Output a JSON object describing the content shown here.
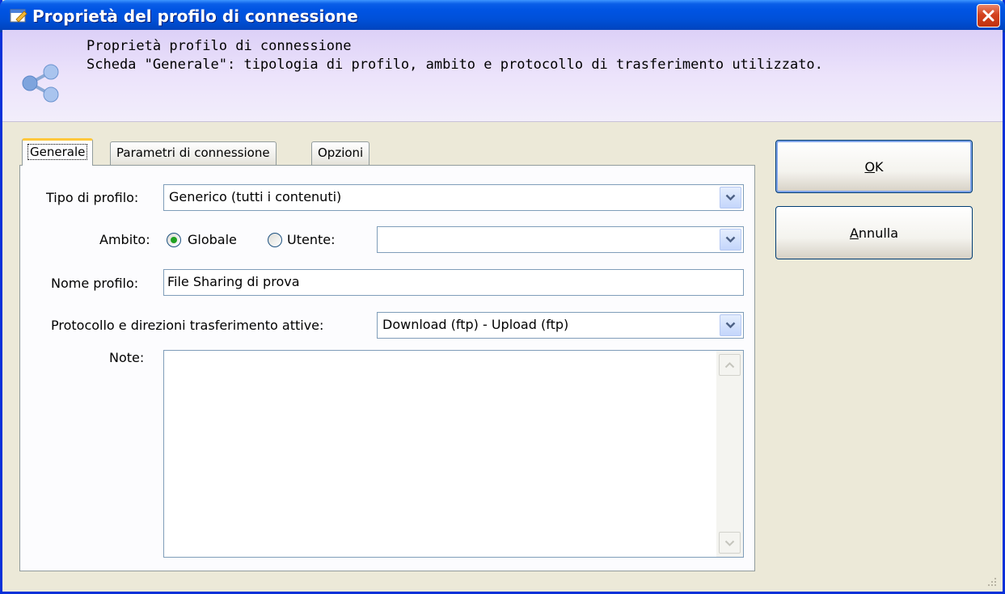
{
  "window": {
    "title": "Proprietà del profilo di connessione"
  },
  "header": {
    "line1": "Proprietà profilo di connessione",
    "line2": "Scheda \"Generale\": tipologia di profilo, ambito e protocollo di trasferimento utilizzato."
  },
  "tabs": [
    {
      "label": "Generale",
      "active": true
    },
    {
      "label": "Parametri di connessione",
      "active": false
    },
    {
      "label": "Opzioni",
      "active": false
    }
  ],
  "form": {
    "tipo_label": "Tipo di profilo:",
    "tipo_value": "Generico (tutti i contenuti)",
    "ambito_label": "Ambito:",
    "radio_globale": "Globale",
    "radio_utente": "Utente:",
    "ambito_selected": "Globale",
    "utente_value": "",
    "nome_label": "Nome profilo:",
    "nome_value": "File Sharing di prova",
    "protocollo_label": "Protocollo e direzioni trasferimento attive:",
    "protocollo_value": "Download (ftp) - Upload (ftp)",
    "note_label": "Note:",
    "note_value": ""
  },
  "buttons": {
    "ok_first": "O",
    "ok_rest": "K",
    "annulla_first": "A",
    "annulla_rest": "nnulla"
  },
  "colors": {
    "titlebar": "#0054e3",
    "close": "#d3431f",
    "header_bg": "#ece3fb",
    "tab_highlight": "#ffc83c",
    "radio_dot": "#21a121"
  },
  "icons": [
    "edit-window-icon",
    "close-icon",
    "share-icon",
    "chevron-down-icon",
    "scroll-up-icon",
    "scroll-down-icon",
    "resize-grip-icon"
  ]
}
